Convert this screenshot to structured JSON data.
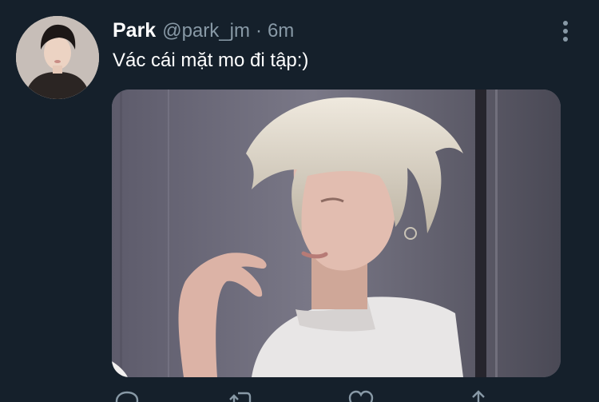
{
  "tweet": {
    "display_name": "Park",
    "handle": "@park_jm",
    "separator": "·",
    "time": "6m",
    "text": "Vác cái mặt mo đi tập:)"
  },
  "icons": {
    "avatar": "profile-photo",
    "more": "more-vertical-icon",
    "reply": "reply-icon",
    "retweet": "retweet-icon",
    "like": "heart-icon",
    "share": "share-icon"
  },
  "colors": {
    "background": "#15202b",
    "primary_text": "#ffffff",
    "secondary_text": "#8899a6"
  }
}
